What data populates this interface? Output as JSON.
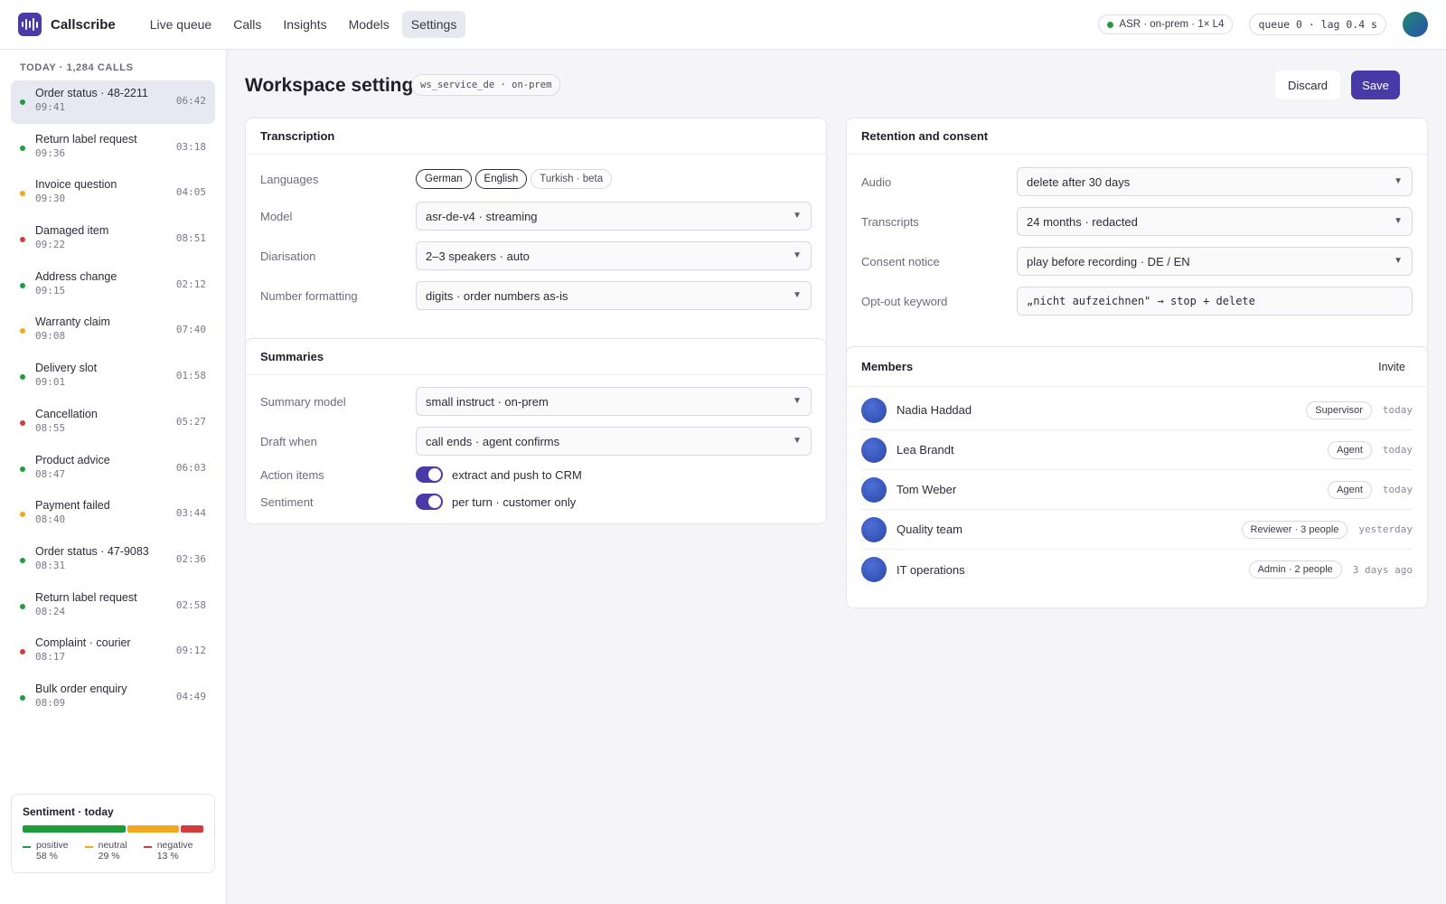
{
  "app": {
    "name": "Callscribe",
    "nav": [
      {
        "label": "Live queue"
      },
      {
        "label": "Calls"
      },
      {
        "label": "Insights"
      },
      {
        "label": "Models"
      },
      {
        "label": "Settings"
      }
    ],
    "status_asr": "ASR · on-prem · 1× L4",
    "status_queue": "queue 0 · lag 0.4 s"
  },
  "sidebar": {
    "heading": "TODAY · 1,284 CALLS",
    "calls": [
      {
        "title": "Order status · 48-2211",
        "time": "09:41",
        "duration": "06:42",
        "sentiment": "#1e9e3a"
      },
      {
        "title": "Return label request",
        "time": "09:36",
        "duration": "03:18",
        "sentiment": "#1e9e3a"
      },
      {
        "title": "Invoice question",
        "time": "09:30",
        "duration": "04:05",
        "sentiment": "#f0a81c"
      },
      {
        "title": "Damaged item",
        "time": "09:22",
        "duration": "08:51",
        "sentiment": "#d23c3c"
      },
      {
        "title": "Address change",
        "time": "09:15",
        "duration": "02:12",
        "sentiment": "#1e9e3a"
      },
      {
        "title": "Warranty claim",
        "time": "09:08",
        "duration": "07:40",
        "sentiment": "#f0a81c"
      },
      {
        "title": "Delivery slot",
        "time": "09:01",
        "duration": "01:58",
        "sentiment": "#1e9e3a"
      },
      {
        "title": "Cancellation",
        "time": "08:55",
        "duration": "05:27",
        "sentiment": "#d23c3c"
      },
      {
        "title": "Product advice",
        "time": "08:47",
        "duration": "06:03",
        "sentiment": "#1e9e3a"
      },
      {
        "title": "Payment failed",
        "time": "08:40",
        "duration": "03:44",
        "sentiment": "#f0a81c"
      },
      {
        "title": "Order status · 47-9083",
        "time": "08:31",
        "duration": "02:36",
        "sentiment": "#1e9e3a"
      },
      {
        "title": "Return label request",
        "time": "08:24",
        "duration": "02:58",
        "sentiment": "#1e9e3a"
      },
      {
        "title": "Complaint · courier",
        "time": "08:17",
        "duration": "09:12",
        "sentiment": "#d23c3c"
      },
      {
        "title": "Bulk order enquiry",
        "time": "08:09",
        "duration": "04:49",
        "sentiment": "#1e9e3a"
      }
    ],
    "sentiment": {
      "title": "Sentiment · today",
      "positive_label": "positive",
      "positive_value": "58 %",
      "positive_fraction": 0.58,
      "neutral_label": "neutral",
      "neutral_value": "29 %",
      "neutral_fraction": 0.29,
      "negative_label": "negative",
      "negative_value": "13 %",
      "negative_fraction": 0.13,
      "colors": {
        "positive": "#1e9e3a",
        "neutral": "#f0a81c",
        "negative": "#d23c3c"
      }
    }
  },
  "page": {
    "title": "Workspace settings",
    "workspace_chip": "ws_service_de · on-prem",
    "discard_label": "Discard",
    "save_label": "Save",
    "accent": "#4a3aa8"
  },
  "transcription": {
    "title": "Transcription",
    "languages_label": "Languages",
    "languages": [
      "German",
      "English",
      "Turkish · beta"
    ],
    "model_label": "Model",
    "model_value": "asr-de-v4 · streaming",
    "diarisation_label": "Diarisation",
    "diarisation_value": "2–3 speakers · auto",
    "number_label": "Number formatting",
    "number_value": "digits · order numbers as-is"
  },
  "summaries": {
    "title": "Summaries",
    "model_label": "Summary model",
    "model_value": "small instruct · on-prem",
    "draft_label": "Draft when",
    "draft_value": "call ends · agent confirms",
    "action_label": "Action items",
    "action_value": "extract and push to CRM",
    "sentiment_label": "Sentiment",
    "sentiment_value": "per turn · customer only"
  },
  "retention": {
    "title": "Retention and consent",
    "audio_label": "Audio",
    "audio_value": "delete after 30 days",
    "transcripts_label": "Transcripts",
    "transcripts_value": "24 months · redacted",
    "consent_label": "Consent notice",
    "consent_value": "play before recording · DE / EN",
    "optout_label": "Opt-out keyword",
    "optout_value": "„nicht aufzeichnen\" → stop + delete"
  },
  "members": {
    "title": "Members",
    "invite_label": "Invite",
    "list": [
      {
        "name": "Nadia Haddad",
        "role": "Supervisor",
        "seen": "today"
      },
      {
        "name": "Lea Brandt",
        "role": "Agent",
        "seen": "today"
      },
      {
        "name": "Tom Weber",
        "role": "Agent",
        "seen": "today"
      },
      {
        "name": "Quality team",
        "role": "Reviewer · 3 people",
        "seen": "yesterday"
      },
      {
        "name": "IT operations",
        "role": "Admin · 2 people",
        "seen": "3 days ago"
      }
    ]
  }
}
